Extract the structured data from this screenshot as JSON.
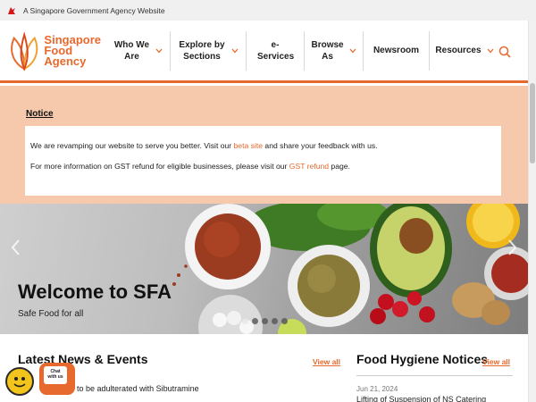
{
  "masthead": {
    "text": "A Singapore Government Agency Website"
  },
  "logo": {
    "line1": "Singapore",
    "line2": "Food",
    "line3": "Agency"
  },
  "nav": {
    "items": [
      {
        "label": "Who We Are",
        "dropdown": true
      },
      {
        "label": "Explore by Sections",
        "dropdown": true
      },
      {
        "label": "e-Services",
        "dropdown": false
      },
      {
        "label": "Browse As",
        "dropdown": true
      },
      {
        "label": "Newsroom",
        "dropdown": false
      },
      {
        "label": "Resources",
        "dropdown": true
      }
    ],
    "search_icon": "search-icon"
  },
  "notice": {
    "title": "Notice",
    "line1_pre": "We are revamping our website to serve you better. Visit our ",
    "line1_link": "beta site",
    "line1_post": " and share your feedback with us.",
    "line2_pre": "For more information on GST refund for eligible businesses, please visit our ",
    "line2_link": "GST refund",
    "line2_post": " page."
  },
  "hero": {
    "title": "Welcome to SFA",
    "subtitle": "Safe Food for all",
    "slides": 5,
    "active_slide": 1
  },
  "news": {
    "title": "Latest News & Events",
    "view_all": "View all",
    "first_item": "…found to be adulterated with Sibutramine"
  },
  "hygiene": {
    "title": "Food Hygiene Notices",
    "view_all": "View all",
    "date": "Jun 21, 2024",
    "first_item": "Lifting of Suspension of NS Catering"
  },
  "chat": {
    "label_line1": "Chat",
    "label_line2": "with us"
  },
  "colors": {
    "brand": "#e7692d",
    "notice_bg": "#f6c9ac"
  }
}
